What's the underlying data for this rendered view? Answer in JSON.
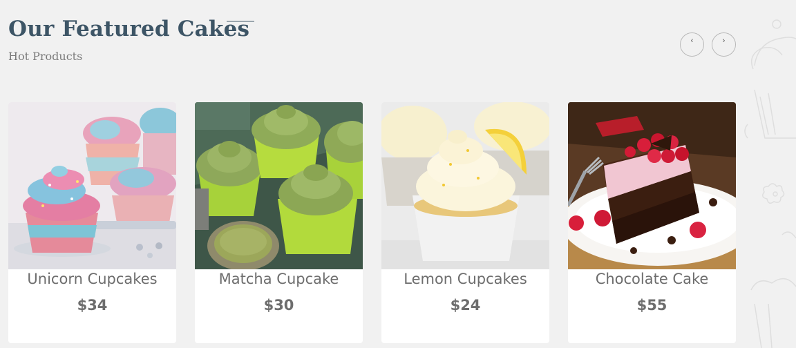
{
  "section": {
    "title": "Our Featured Cakes",
    "subtitle": "Hot Products"
  },
  "nav": {
    "prev_icon": "‹",
    "next_icon": "›"
  },
  "products": [
    {
      "name": "Unicorn Cupcakes",
      "price": "$34",
      "image": "unicorn-cupcakes-photo"
    },
    {
      "name": "Matcha Cupcake",
      "price": "$30",
      "image": "matcha-cupcake-photo"
    },
    {
      "name": "Lemon Cupcakes",
      "price": "$24",
      "image": "lemon-cupcakes-photo"
    },
    {
      "name": "Chocolate Cake",
      "price": "$55",
      "image": "chocolate-cake-photo"
    }
  ]
}
